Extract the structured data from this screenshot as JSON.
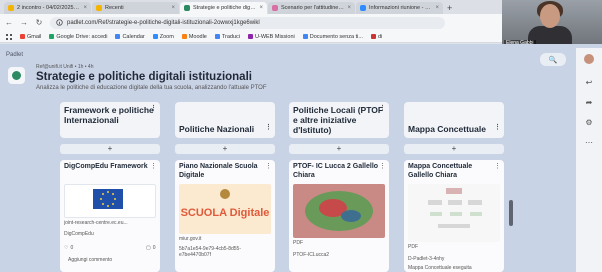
{
  "browser": {
    "tabs": [
      {
        "label": "2 incontro - 04/02/2025 - Goo",
        "color": "#f4b400",
        "active": false
      },
      {
        "label": "Recenti",
        "color": "#f4b400",
        "active": false
      },
      {
        "label": "Strategie e politiche digitali ist",
        "color": "#2c8a62",
        "active": true
      },
      {
        "label": "Scenario per l'attitudine ad aut",
        "color": "#d96fa3",
        "active": false
      },
      {
        "label": "Informazioni riunione - Zoom",
        "color": "#2d8cff",
        "active": false
      }
    ],
    "new_tab": "+",
    "close_glyph": "×",
    "url": "padlet.com/Ref/strategie-e-politiche-digitali-istituzionali-2owwxj1kge6wikl",
    "nav": {
      "back": "←",
      "forward": "→",
      "reload": "↻"
    },
    "bookmarks": [
      {
        "label": "Gmail",
        "color": "#ea4335"
      },
      {
        "label": "Google Drive: accedi",
        "color": "#1fa463"
      },
      {
        "label": "Calendar",
        "color": "#4285f4"
      },
      {
        "label": "Zoom",
        "color": "#2d8cff"
      },
      {
        "label": "Moodle",
        "color": "#f98012"
      },
      {
        "label": "Traduci",
        "color": "#4285f4"
      },
      {
        "label": "U-WEB Missioni",
        "color": "#8e24aa"
      },
      {
        "label": "Documento senza ti...",
        "color": "#4285f4"
      },
      {
        "label": "di",
        "color": "#cc3333"
      }
    ]
  },
  "video": {
    "name": "Elena Gabbi"
  },
  "padlet": {
    "app_label": "Padlet",
    "author": "Ref@unifi.it Unifi • 1h • 4h",
    "title": "Strategie e politiche digitali istituzionali",
    "subtitle": "Analizza le politiche di educazione digitale della tua scuola, analizzando l'attuale PTOF",
    "search_icon": "🔍",
    "add_glyph": "+",
    "more_glyph": "⋮",
    "columns": [
      {
        "title": "Framework e politiche Internazionali",
        "card": {
          "title": "DigCompEdu Framework",
          "caption": "joint-research-centre.ec.eu...",
          "meta": "DigCompEdu",
          "likes": "0",
          "comments": "0",
          "add_comment": "Aggiungi commento"
        }
      },
      {
        "title": "Politiche Nazionali",
        "card": {
          "title": "Piano Nazionale Scuola Digitale",
          "image_text": "SCUOLA Digitale",
          "caption": "miur.gov.it",
          "meta": "5b7a1e54-9e79-4cb5-8d55-e7be4470b07f"
        }
      },
      {
        "title": "Politiche Locali (PTOF e altre iniziative d'Istituto)",
        "card": {
          "title": "PTOF- IC Lucca 2 Gallello Chiara",
          "badge": "PDF",
          "meta": "PTOF-ICLucca2"
        }
      },
      {
        "title": "Mappa Concettuale",
        "card": {
          "title": "Mappa Concettuale Gallello Chiara",
          "badge": "PDF",
          "meta": "D-Padlet-3-4nhy",
          "caption": "Mappa Concettuale eseguita"
        }
      }
    ]
  }
}
